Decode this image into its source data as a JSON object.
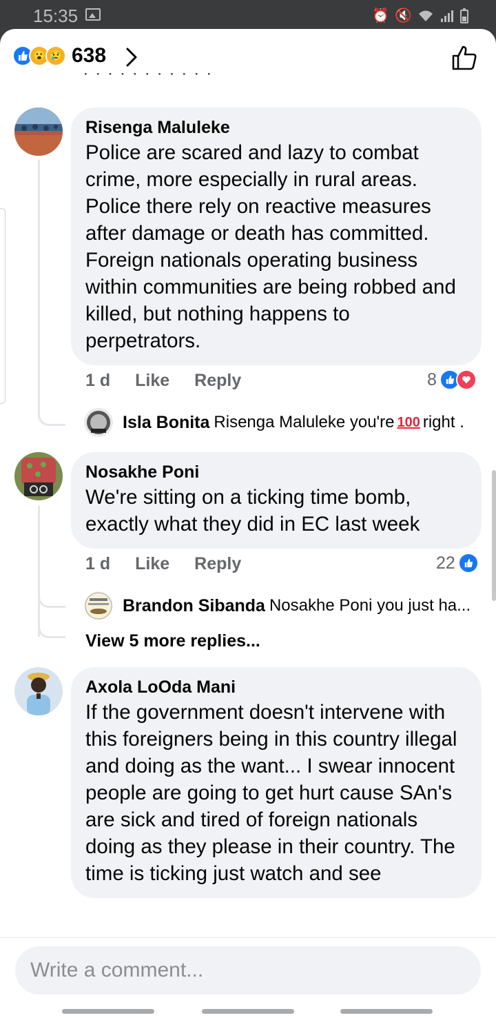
{
  "status_bar": {
    "time": "15:35"
  },
  "header": {
    "reaction_count": "638"
  },
  "comments": [
    {
      "author": "Risenga Maluleke",
      "text": "Police are scared and lazy to combat crime, more especially in rural areas. Police there rely on reactive measures after damage or death has committed. Foreign nationals operating business within communities are being robbed and killed, but nothing happens to perpetrators.",
      "time": "1 d",
      "like_label": "Like",
      "reply_label": "Reply",
      "reaction_count": "8",
      "reply": {
        "author": "Isla Bonita",
        "text_before": "Risenga Maluleke you're",
        "emoji": "100",
        "text_after": "right ."
      }
    },
    {
      "author": "Nosakhe Poni",
      "text": "We're sitting on a ticking time bomb, exactly what they did in EC last week",
      "time": "1 d",
      "like_label": "Like",
      "reply_label": "Reply",
      "reaction_count": "22",
      "reply": {
        "author": "Brandon Sibanda",
        "text": "Nosakhe Poni you just ha..."
      },
      "view_more": "View 5 more replies..."
    },
    {
      "author": "Axola LoOda Mani",
      "text": "If the government doesn't intervene with this foreigners being in this country illegal and doing as the want... I swear innocent people are going to get hurt cause SAn's are sick and tired of foreign nationals doing as they please in their country. The time is ticking just watch and see"
    }
  ],
  "composer": {
    "placeholder": "Write a comment..."
  },
  "colors": {
    "accent": "#1877f2",
    "bubble": "#f0f2f5",
    "meta": "#65676b",
    "love": "#f33e58"
  }
}
